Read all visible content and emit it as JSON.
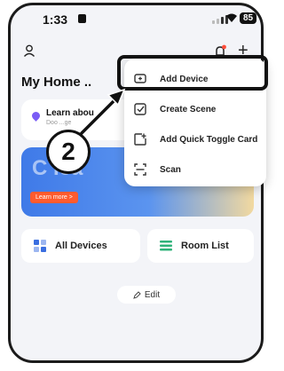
{
  "status_bar": {
    "time": "1:33",
    "battery": "85"
  },
  "home": {
    "title": "My Home .."
  },
  "banner": {
    "title": "Learn abou",
    "subtitle": "Doo ...ge"
  },
  "promo": {
    "text": "C   Ica",
    "button": "Learn more >"
  },
  "tiles": {
    "all_devices": "All Devices",
    "room_list": "Room List"
  },
  "edit": {
    "label": "Edit"
  },
  "menu": {
    "items": [
      {
        "label": "Add Device",
        "icon": "add-device-icon"
      },
      {
        "label": "Create Scene",
        "icon": "create-scene-icon"
      },
      {
        "label": "Add Quick Toggle Card",
        "icon": "add-card-icon"
      },
      {
        "label": "Scan",
        "icon": "scan-icon"
      }
    ]
  },
  "annotation": {
    "step": "2"
  },
  "colors": {
    "accent": "#7a5cf5",
    "notification": "#ff4d3a",
    "promo_button": "#ff5b2e",
    "room_icon": "#2fb37a"
  }
}
